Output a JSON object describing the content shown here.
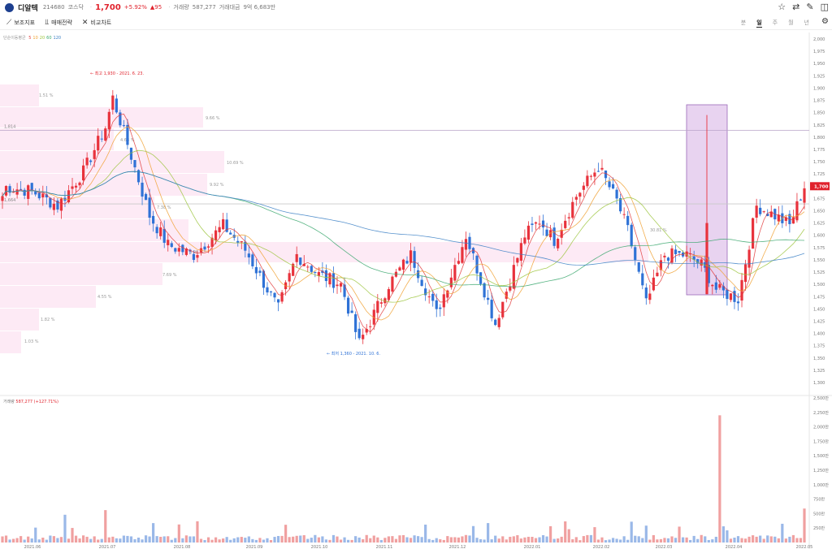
{
  "header": {
    "name": "디알텍",
    "code": "214680",
    "market": "코스닥",
    "price": "1,700",
    "change_pct": "+5.92%",
    "change": "▲95",
    "volume_label": "거래량",
    "volume": "587,277",
    "amount_label": "거래대금",
    "amount": "9억 6,683만"
  },
  "toolbar": {
    "indicator": "보조지표",
    "strategy": "매매전략",
    "compare": "비교차트",
    "periods": [
      "분",
      "일",
      "주",
      "월",
      "년"
    ],
    "active_period": "일"
  },
  "ma_legend": {
    "label": "단순이동평균",
    "periods": [
      "5",
      "10",
      "20",
      "60",
      "120"
    ],
    "colors": [
      "#e03a3a",
      "#f0a030",
      "#9bc43c",
      "#3aa76d",
      "#3a7fc4"
    ]
  },
  "volume_legend": {
    "label": "거래량",
    "value": "587,277 (+127.71%)"
  },
  "chart_data": {
    "type": "candlestick",
    "price_axis": {
      "min": 1300,
      "max": 2000,
      "ticks": [
        "2,000",
        "1,975",
        "1,950",
        "1,925",
        "1,900",
        "1,875",
        "1,850",
        "1,825",
        "1,800",
        "1,775",
        "1,750",
        "1,725",
        "1,700",
        "1,675",
        "1,650",
        "1,625",
        "1,600",
        "1,575",
        "1,550",
        "1,525",
        "1,500",
        "1,475",
        "1,450",
        "1,425",
        "1,400",
        "1,375",
        "1,350",
        "1,325",
        "1,300"
      ],
      "last_price_label": "1,700"
    },
    "volume_axis": {
      "min": 0,
      "max": 2500000,
      "ticks": [
        "2,500만",
        "2,250만",
        "2,000만",
        "1,750만",
        "1,500만",
        "1,250만",
        "1,000만",
        "750만",
        "500만",
        "250만"
      ]
    },
    "x_axis": {
      "labels": [
        "2021.06",
        "2021.07",
        "2021.08",
        "2021.09",
        "2021.10",
        "2021.11",
        "2021.12",
        "2022.01",
        "2022.02",
        "2022.03",
        "2022.04",
        "2022.05"
      ]
    },
    "horizontal_lines": [
      {
        "value": 1814,
        "label": "1,814"
      },
      {
        "value": 1664,
        "label": "1,664"
      }
    ],
    "annotations": {
      "high": "최고 1,930 - 2021. 6. 23.",
      "low": "최저 1,360 - 2021. 10. 6."
    },
    "volume_profile": {
      "labels": [
        "1.51 %",
        "9.66 %",
        "4.68 %",
        "10.69 %",
        "9.92 %",
        "7.38 %",
        "8.96 %",
        "30.81 %",
        "7.69 %",
        "4.55 %",
        "1.82 %",
        "1.03 %"
      ]
    }
  }
}
